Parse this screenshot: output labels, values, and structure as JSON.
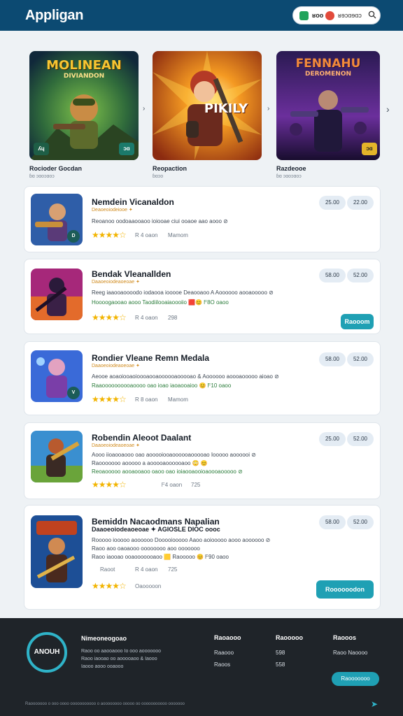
{
  "header": {
    "brand": "Appligan",
    "pill_label_1": "ʁoo",
    "pill_label_2": "ʁɘɔɑɘɑɔ",
    "search_icon": "search-icon"
  },
  "featured": [
    {
      "art_title": "MOLINEAN",
      "art_sub": "DIVIANDON",
      "title": "Rocioder Gocdan",
      "sub": "ɓɑ ɔɑoɔɑoɔ",
      "badge": "ʎɥ"
    },
    {
      "art_title": "PIKILY",
      "art_sub": "",
      "title": "Reopaction",
      "sub": "ɓɑɔo",
      "badge": ""
    },
    {
      "art_title": "FENNAHU",
      "art_sub": "DEROMENON",
      "title": "Razdeooe",
      "sub": "ɓɑ ɔɑoɔɑoɔ",
      "badge": "ɔɑ"
    }
  ],
  "cards": [
    {
      "title": "Nemdein Vicanaldon",
      "sub": "Deaoeoiodeiooe ✦",
      "line1": "Reoanoo oodoaaooaoo ioiooae  ciui ooaoe  aao aooo  ⊘",
      "line2": "",
      "meta1": "R 4 oaon",
      "meta2": "Mamom",
      "chip1": "25.00",
      "chip2": "22.00",
      "button": ""
    },
    {
      "title": "Bendak Vleanallden",
      "sub": "Daaoeoiodeaoeoae ✦",
      "line1": "Reeg iaaooaoooodo iodaooa iooooe Deaooaoo  A Aoooooo aooaooooo ⊘",
      "line2": "Hoooogaooao aooo Taodiilooaiaoooiio 🟥😊  ᖴ8O oaoo",
      "meta1": "R 4 oaon",
      "meta2": "298",
      "chip1": "58.00",
      "chip2": "52.00",
      "button": "Raooom"
    },
    {
      "title": "Rondier Vleane Remn Medala",
      "sub": "Daaoeoiodeaoeoae ✦",
      "line1": "Aeooe aoaoiooaoioooaooaoooooaooooao & Aoooooo aoooaooooo aioao ⊘",
      "line2": "Raaoooooooooaoooo oao ioao iaoaooaioo 😊  ᖴ10 oaoo",
      "meta1": "R 8 oaon",
      "meta2": "Mamom",
      "chip1": "58.00",
      "chip2": "52.00",
      "button": ""
    },
    {
      "title": "Robendin Aleoot Daalant",
      "sub": "Daaoeoiodeaoeoae ✦",
      "line1": "Aooo iioaooaooo oao aooooiooaoooooaooooao  Iooooo aoooooi ⊘",
      "line2": "Raooooooo aooooo a aooooaoooooaoo 😳  😊",
      "line3": "Reoaooooo aooaooaoo oaoo oao ioiaooaooioaoooaooooo ⊘",
      "meta1": "ᖴ4 oaon",
      "meta2": "725",
      "chip1": "25.00",
      "chip2": "52.00",
      "button": ""
    },
    {
      "title": "Bemiddn Nacaodmans Napalian",
      "sub": "Daaoeoiodeaoeoae ✦  AGIOSLE DIOC oooc",
      "line1": "Rooooo iooooo aoooooo  Dooooiooooo Aaoo aoiooooo  aooo aoooooo  ⊘",
      "line2": "Raoo aoo oaoaooo  oooooooo aoo ooooooo",
      "line3": "Raoo iaooao ooaooooooaoo 🟨  Raooooo 😊  ᖴ90 oaoo",
      "meta1": "Raoot",
      "meta1b": "R 4 oaon",
      "meta2": "725",
      "meta2b": "Oaooooon",
      "chip1": "58.00",
      "chip2": "52.00",
      "button": "Roooooodon"
    }
  ],
  "footer": {
    "logo_text": "ANOUH",
    "brand": "Nimeoneogoao",
    "desc": [
      "Raoo oo aaooaooo  Io ooo aooooooo",
      "Raoo iaooao oo aooooaoo  &  Iaooo",
      "Iaooo aooo  ooaooo"
    ],
    "col1_head": "Raoaooo",
    "col1_links": [
      "Raaooo",
      "Raoos"
    ],
    "col2_head": "Raooooo",
    "col2_links": [
      "598",
      "558"
    ],
    "col3_head": "Raooos",
    "col3_links": [
      "Raoo Naoooo"
    ],
    "button": "Raooooooo",
    "copyright": "Raooooooo o ooo oooo ooooooooooo o aoooooooo ooooo oo ooooooooooo ooooooo"
  },
  "colors": {
    "header_bg": "#0c4a72",
    "accent": "#1fa0b4",
    "star": "#f2b400",
    "footer_bg": "#1f2429"
  }
}
